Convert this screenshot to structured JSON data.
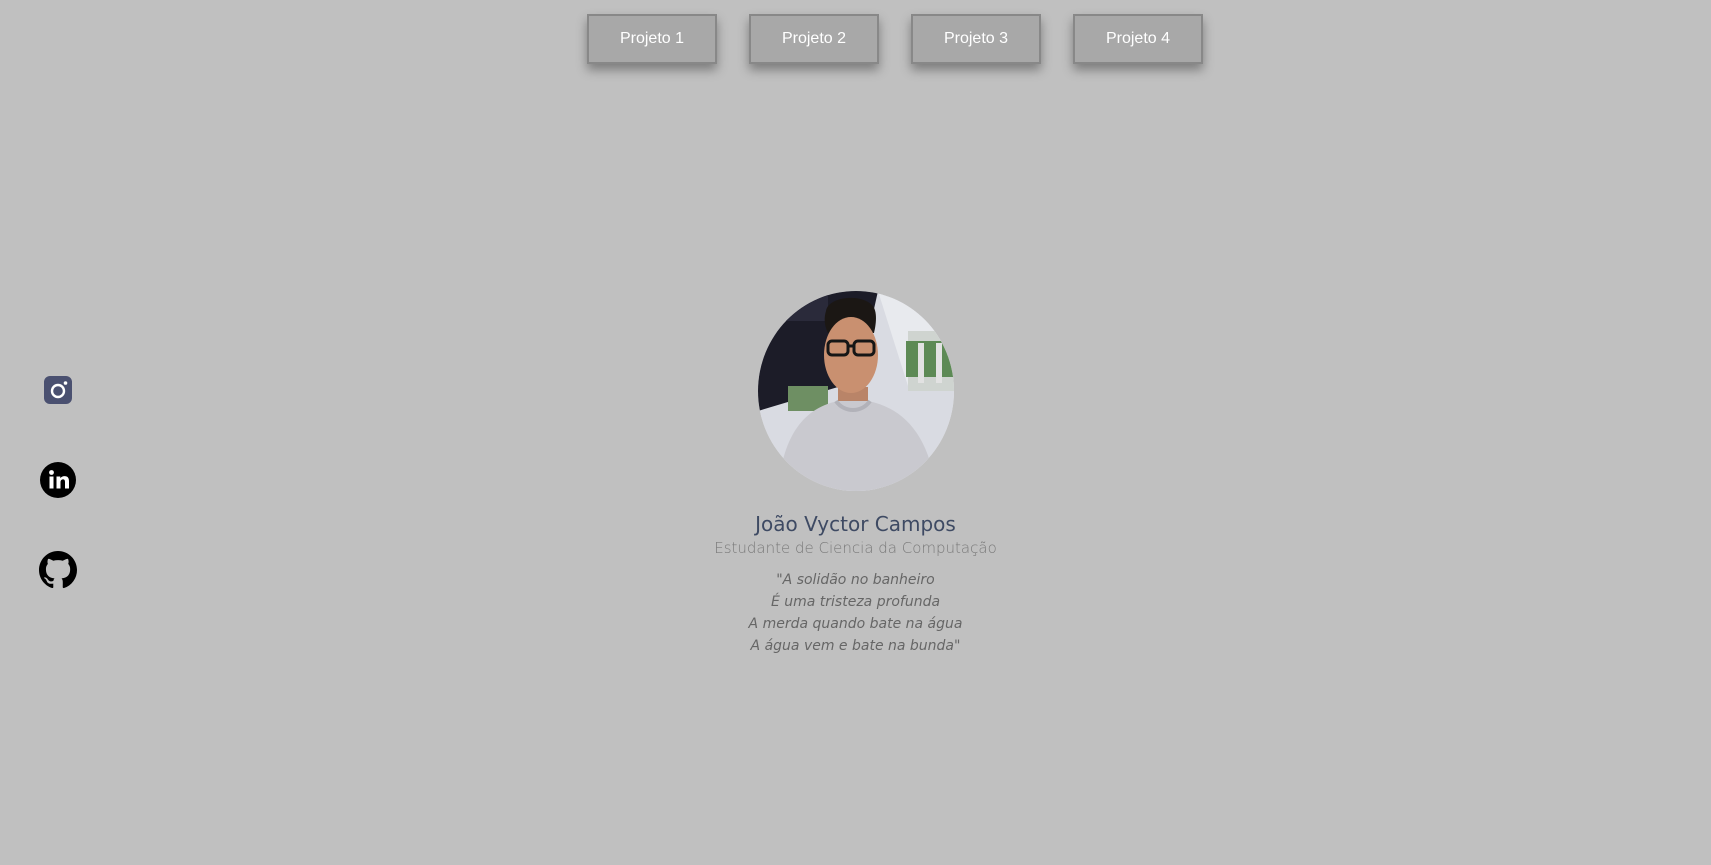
{
  "nav": {
    "buttons": [
      {
        "label": "Projeto 1"
      },
      {
        "label": "Projeto 2"
      },
      {
        "label": "Projeto 3"
      },
      {
        "label": "Projeto 4"
      }
    ]
  },
  "social": {
    "items": [
      {
        "icon": "instagram-icon",
        "color": "#4a5070"
      },
      {
        "icon": "linkedin-icon",
        "color": "#000000"
      },
      {
        "icon": "github-icon",
        "color": "#000000"
      }
    ]
  },
  "profile": {
    "name": "João Vyctor Campos",
    "role": "Estudante de Ciencia da Computação",
    "quote_lines": [
      "\"A solidão no banheiro",
      "É uma tristeza profunda",
      "A merda quando bate na água",
      "A água vem e bate na bunda\""
    ]
  },
  "colors": {
    "background": "#c0c0c0",
    "button_bg": "#a8a8a8",
    "name_text": "#3e4a63"
  }
}
